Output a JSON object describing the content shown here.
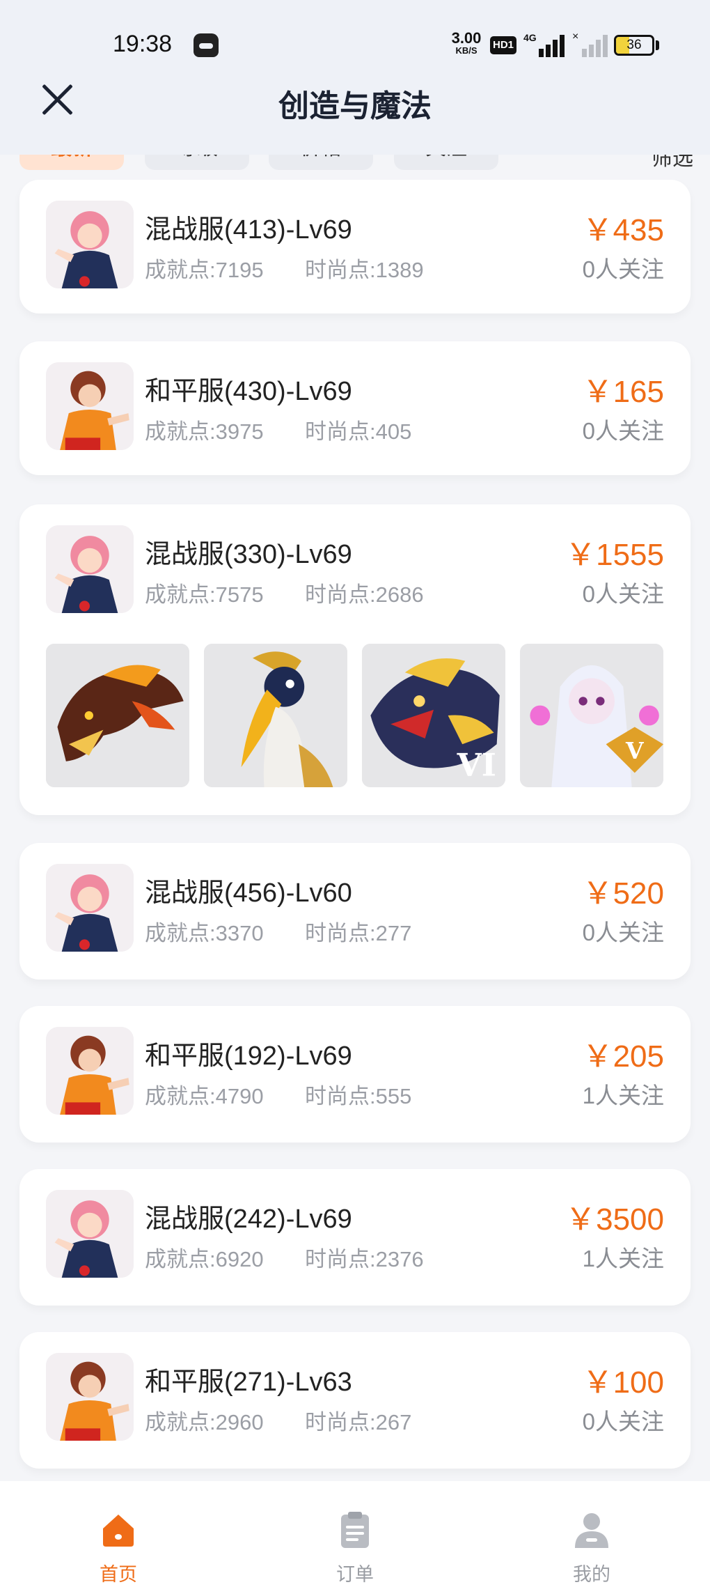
{
  "status_bar": {
    "time": "19:38",
    "net_speed_value": "3.00",
    "net_speed_unit": "KB/S",
    "hd_badge": "HD1",
    "network_type": "4G",
    "battery_percent": "36",
    "battery_level": 0.36
  },
  "header": {
    "title": "创造与魔法",
    "close_icon": "close-icon"
  },
  "filters": {
    "chips": [
      "最新",
      "等级",
      "价格",
      "关注"
    ],
    "more": "筛选",
    "active_index": 0
  },
  "listings": [
    {
      "title": "混战服(413)-Lv69",
      "achievement": "成就点:7195",
      "fashion": "时尚点:1389",
      "price": "￥435",
      "followers": "0人关注",
      "avatar": "pink-hair-girl-avatar"
    },
    {
      "title": "和平服(430)-Lv69",
      "achievement": "成就点:3975",
      "fashion": "时尚点:405",
      "price": "￥165",
      "followers": "0人关注",
      "avatar": "brown-hair-boy-avatar"
    },
    {
      "title": "混战服(330)-Lv69",
      "achievement": "成就点:7575",
      "fashion": "时尚点:2686",
      "price": "￥1555",
      "followers": "0人关注",
      "avatar": "pink-hair-girl-avatar",
      "thumbnails": [
        {
          "name": "fire-dragon-mount",
          "badge": ""
        },
        {
          "name": "hornbill-bird-mount",
          "badge": ""
        },
        {
          "name": "golden-dragon-mount",
          "badge": "VI"
        },
        {
          "name": "white-spirit-pet",
          "badge": "V"
        }
      ]
    },
    {
      "title": "混战服(456)-Lv60",
      "achievement": "成就点:3370",
      "fashion": "时尚点:277",
      "price": "￥520",
      "followers": "0人关注",
      "avatar": "pink-hair-girl-avatar"
    },
    {
      "title": "和平服(192)-Lv69",
      "achievement": "成就点:4790",
      "fashion": "时尚点:555",
      "price": "￥205",
      "followers": "1人关注",
      "avatar": "brown-hair-boy-avatar"
    },
    {
      "title": "混战服(242)-Lv69",
      "achievement": "成就点:6920",
      "fashion": "时尚点:2376",
      "price": "￥3500",
      "followers": "1人关注",
      "avatar": "pink-hair-girl-avatar"
    },
    {
      "title": "和平服(271)-Lv63",
      "achievement": "成就点:2960",
      "fashion": "时尚点:267",
      "price": "￥100",
      "followers": "0人关注",
      "avatar": "brown-hair-boy-avatar"
    }
  ],
  "tabbar": {
    "items": [
      {
        "label": "首页",
        "icon": "home-icon",
        "active": true
      },
      {
        "label": "订单",
        "icon": "clipboard-icon",
        "active": false
      },
      {
        "label": "我的",
        "icon": "user-icon",
        "active": false
      }
    ]
  },
  "colors": {
    "accent": "#ef6c17",
    "text_muted": "#9b9ea5",
    "header_bg": "#eef1f7",
    "page_bg": "#f4f5f8"
  }
}
